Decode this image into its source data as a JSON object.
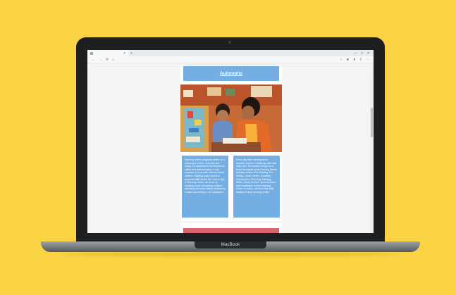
{
  "browser": {
    "tab_close": "×",
    "new_tab": "+",
    "nav": {
      "back": "←",
      "forward": "→",
      "reload": "⟳",
      "home": "⌂"
    },
    "right_icons": [
      "☆",
      "★",
      "⬇",
      "⇪",
      "⋯"
    ],
    "window_controls": [
      "–",
      "□",
      "×"
    ]
  },
  "page": {
    "header_title": "Autonomy",
    "left_column": "Running Seed's programs center on a philosophy of love, nurturing and caring. As explained in the mushroom called view that education is one purposes is to provide skills for future careers. Reading books shows or prepares skills for the life. That is why at Running Seeds, we focus on boosting a love of learning: children attending the media allows developing to start succeeding in our production.",
    "right_column": "Every day after morning circle, students receive a challenge with their daily card. The teacher brings out a board alongside of the Running Seeds learning centers (Pre-Reading, Pre-Writing, Tactile Center, Creativity, Construction, Role Play, Painting, Water, Sand). At once, students place their challenges on their learning center of choice, and then find daily addition to their learning center."
  },
  "laptop": {
    "brand": "MacBook"
  },
  "colors": {
    "background": "#fbd446",
    "accent_blue": "#74aee2",
    "accent_red": "#d7646c"
  }
}
